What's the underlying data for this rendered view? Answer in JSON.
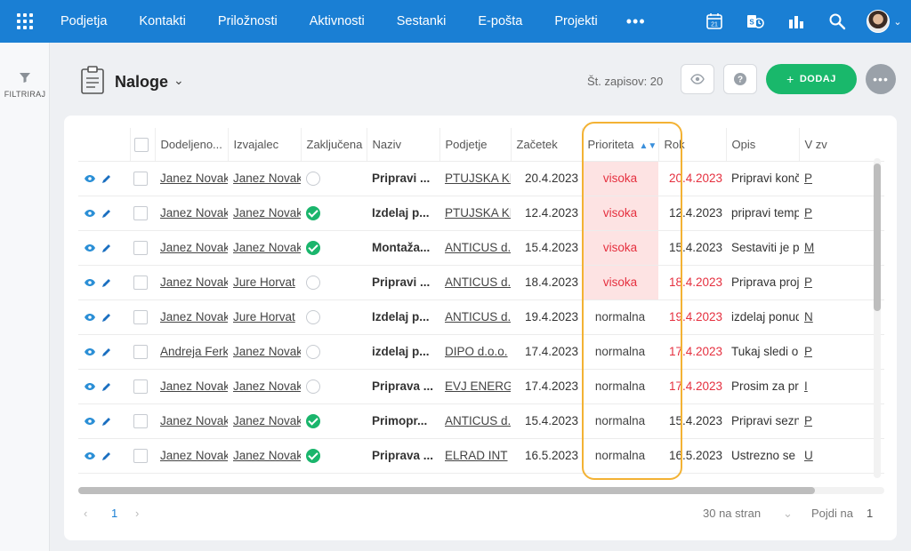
{
  "nav": {
    "items": [
      "Podjetja",
      "Kontakti",
      "Priložnosti",
      "Aktivnosti",
      "Sestanki",
      "E-pošta",
      "Projekti"
    ],
    "more": "•••",
    "calendar_day": "21"
  },
  "sidebar": {
    "filter_label": "FILTRIRAJ"
  },
  "header": {
    "title": "Naloge",
    "record_count": "Št. zapisov: 20",
    "add_label": "DODAJ",
    "add_plus": "+",
    "more": "•••"
  },
  "table": {
    "columns": [
      "Dodeljeno...",
      "Izvajalec",
      "Zaključena",
      "Naziv",
      "Podjetje",
      "Začetek",
      "Prioriteta",
      "Rok",
      "Opis",
      "V zv"
    ],
    "rows": [
      {
        "assigned": "Janez Novak",
        "executor": "Janez Novak",
        "done": false,
        "title": "Pripravi ...",
        "company": "PTUJSKA KLET",
        "start": "20.4.2023",
        "priority": "visoka",
        "due": "20.4.2023",
        "due_red": true,
        "desc": "Pripravi končni ...",
        "rel": "P"
      },
      {
        "assigned": "Janez Novak",
        "executor": "Janez Novak",
        "done": true,
        "title": "Izdelaj p...",
        "company": "PTUJSKA KLET",
        "start": "12.4.2023",
        "priority": "visoka",
        "due": "12.4.2023",
        "due_red": false,
        "desc": "pripravi templat...",
        "rel": "P"
      },
      {
        "assigned": "Janez Novak",
        "executor": "Janez Novak",
        "done": true,
        "title": "Montaža...",
        "company": "ANTICUS d.o.o.",
        "start": "15.4.2023",
        "priority": "visoka",
        "due": "15.4.2023",
        "due_red": false,
        "desc": "Sestaviti je potr...",
        "rel": "M"
      },
      {
        "assigned": "Janez Novak",
        "executor": "Jure Horvat",
        "done": false,
        "title": "Pripravi ...",
        "company": "ANTICUS d.o.o.",
        "start": "18.4.2023",
        "priority": "visoka",
        "due": "18.4.2023",
        "due_red": true,
        "desc": "Priprava projekt...",
        "rel": "P"
      },
      {
        "assigned": "Janez Novak",
        "executor": "Jure Horvat",
        "done": false,
        "title": "Izdelaj p...",
        "company": "ANTICUS d.o.o.",
        "start": "19.4.2023",
        "priority": "normalna",
        "due": "19.4.2023",
        "due_red": true,
        "desc": "izdelaj ponudbo.",
        "rel": "N"
      },
      {
        "assigned": "Andreja Ferk",
        "executor": "Janez Novak",
        "done": false,
        "title": "izdelaj p...",
        "company": "DIPO d.o.o.",
        "start": "17.4.2023",
        "priority": "normalna",
        "due": "17.4.2023",
        "due_red": true,
        "desc": "Tukaj sledi opis ...",
        "rel": "P"
      },
      {
        "assigned": "Janez Novak",
        "executor": "Janez Novak",
        "done": false,
        "title": "Priprava ...",
        "company": "EVJ ENERGIJA",
        "start": "17.4.2023",
        "priority": "normalna",
        "due": "17.4.2023",
        "due_red": true,
        "desc": "Prosim za pripr...",
        "rel": "I"
      },
      {
        "assigned": "Janez Novak",
        "executor": "Janez Novak",
        "done": true,
        "title": "Primopr...",
        "company": "ANTICUS d.o.o.",
        "start": "15.4.2023",
        "priority": "normalna",
        "due": "15.4.2023",
        "due_red": false,
        "desc": "Pripravi seznam...",
        "rel": "P"
      },
      {
        "assigned": "Janez Novak",
        "executor": "Janez Novak",
        "done": true,
        "title": "Priprava ...",
        "company": "ELRAD INT",
        "start": "16.5.2023",
        "priority": "normalna",
        "due": "16.5.2023",
        "due_red": false,
        "desc": "Ustrezno se pri...",
        "rel": "U"
      }
    ]
  },
  "pager": {
    "prev": "‹",
    "page": "1",
    "next": "›",
    "per_page": "30 na stran",
    "goto_label": "Pojdi na",
    "goto_value": "1"
  },
  "colors": {
    "brand": "#1a7fd4",
    "add_green": "#19b86b",
    "high_bg": "#fde3e3",
    "red": "#e5303f",
    "highlight": "#f3b234"
  }
}
